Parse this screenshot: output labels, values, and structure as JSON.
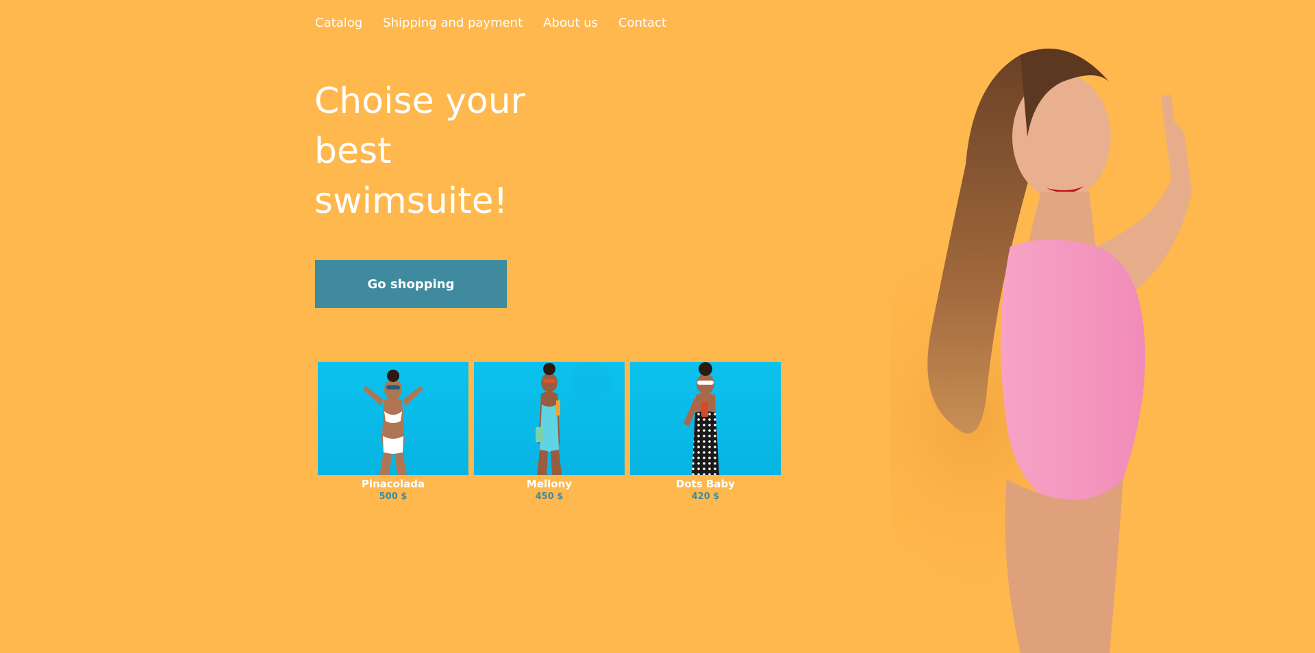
{
  "nav": {
    "items": [
      {
        "label": "Catalog"
      },
      {
        "label": "Shipping and payment"
      },
      {
        "label": "About us"
      },
      {
        "label": "Contact"
      }
    ]
  },
  "hero": {
    "title": "Choise your best swimsuite!",
    "cta_label": "Go shopping"
  },
  "products": [
    {
      "name": "Pinacolada",
      "price": "500 $"
    },
    {
      "name": "Mellony",
      "price": "450 $"
    },
    {
      "name": "Dots Baby",
      "price": "420 $"
    }
  ],
  "colors": {
    "background": "#FFB84D",
    "accent": "#3F8A9E",
    "product_bg": "#0CC1EE",
    "swimsuit": "#F7A3C6"
  }
}
